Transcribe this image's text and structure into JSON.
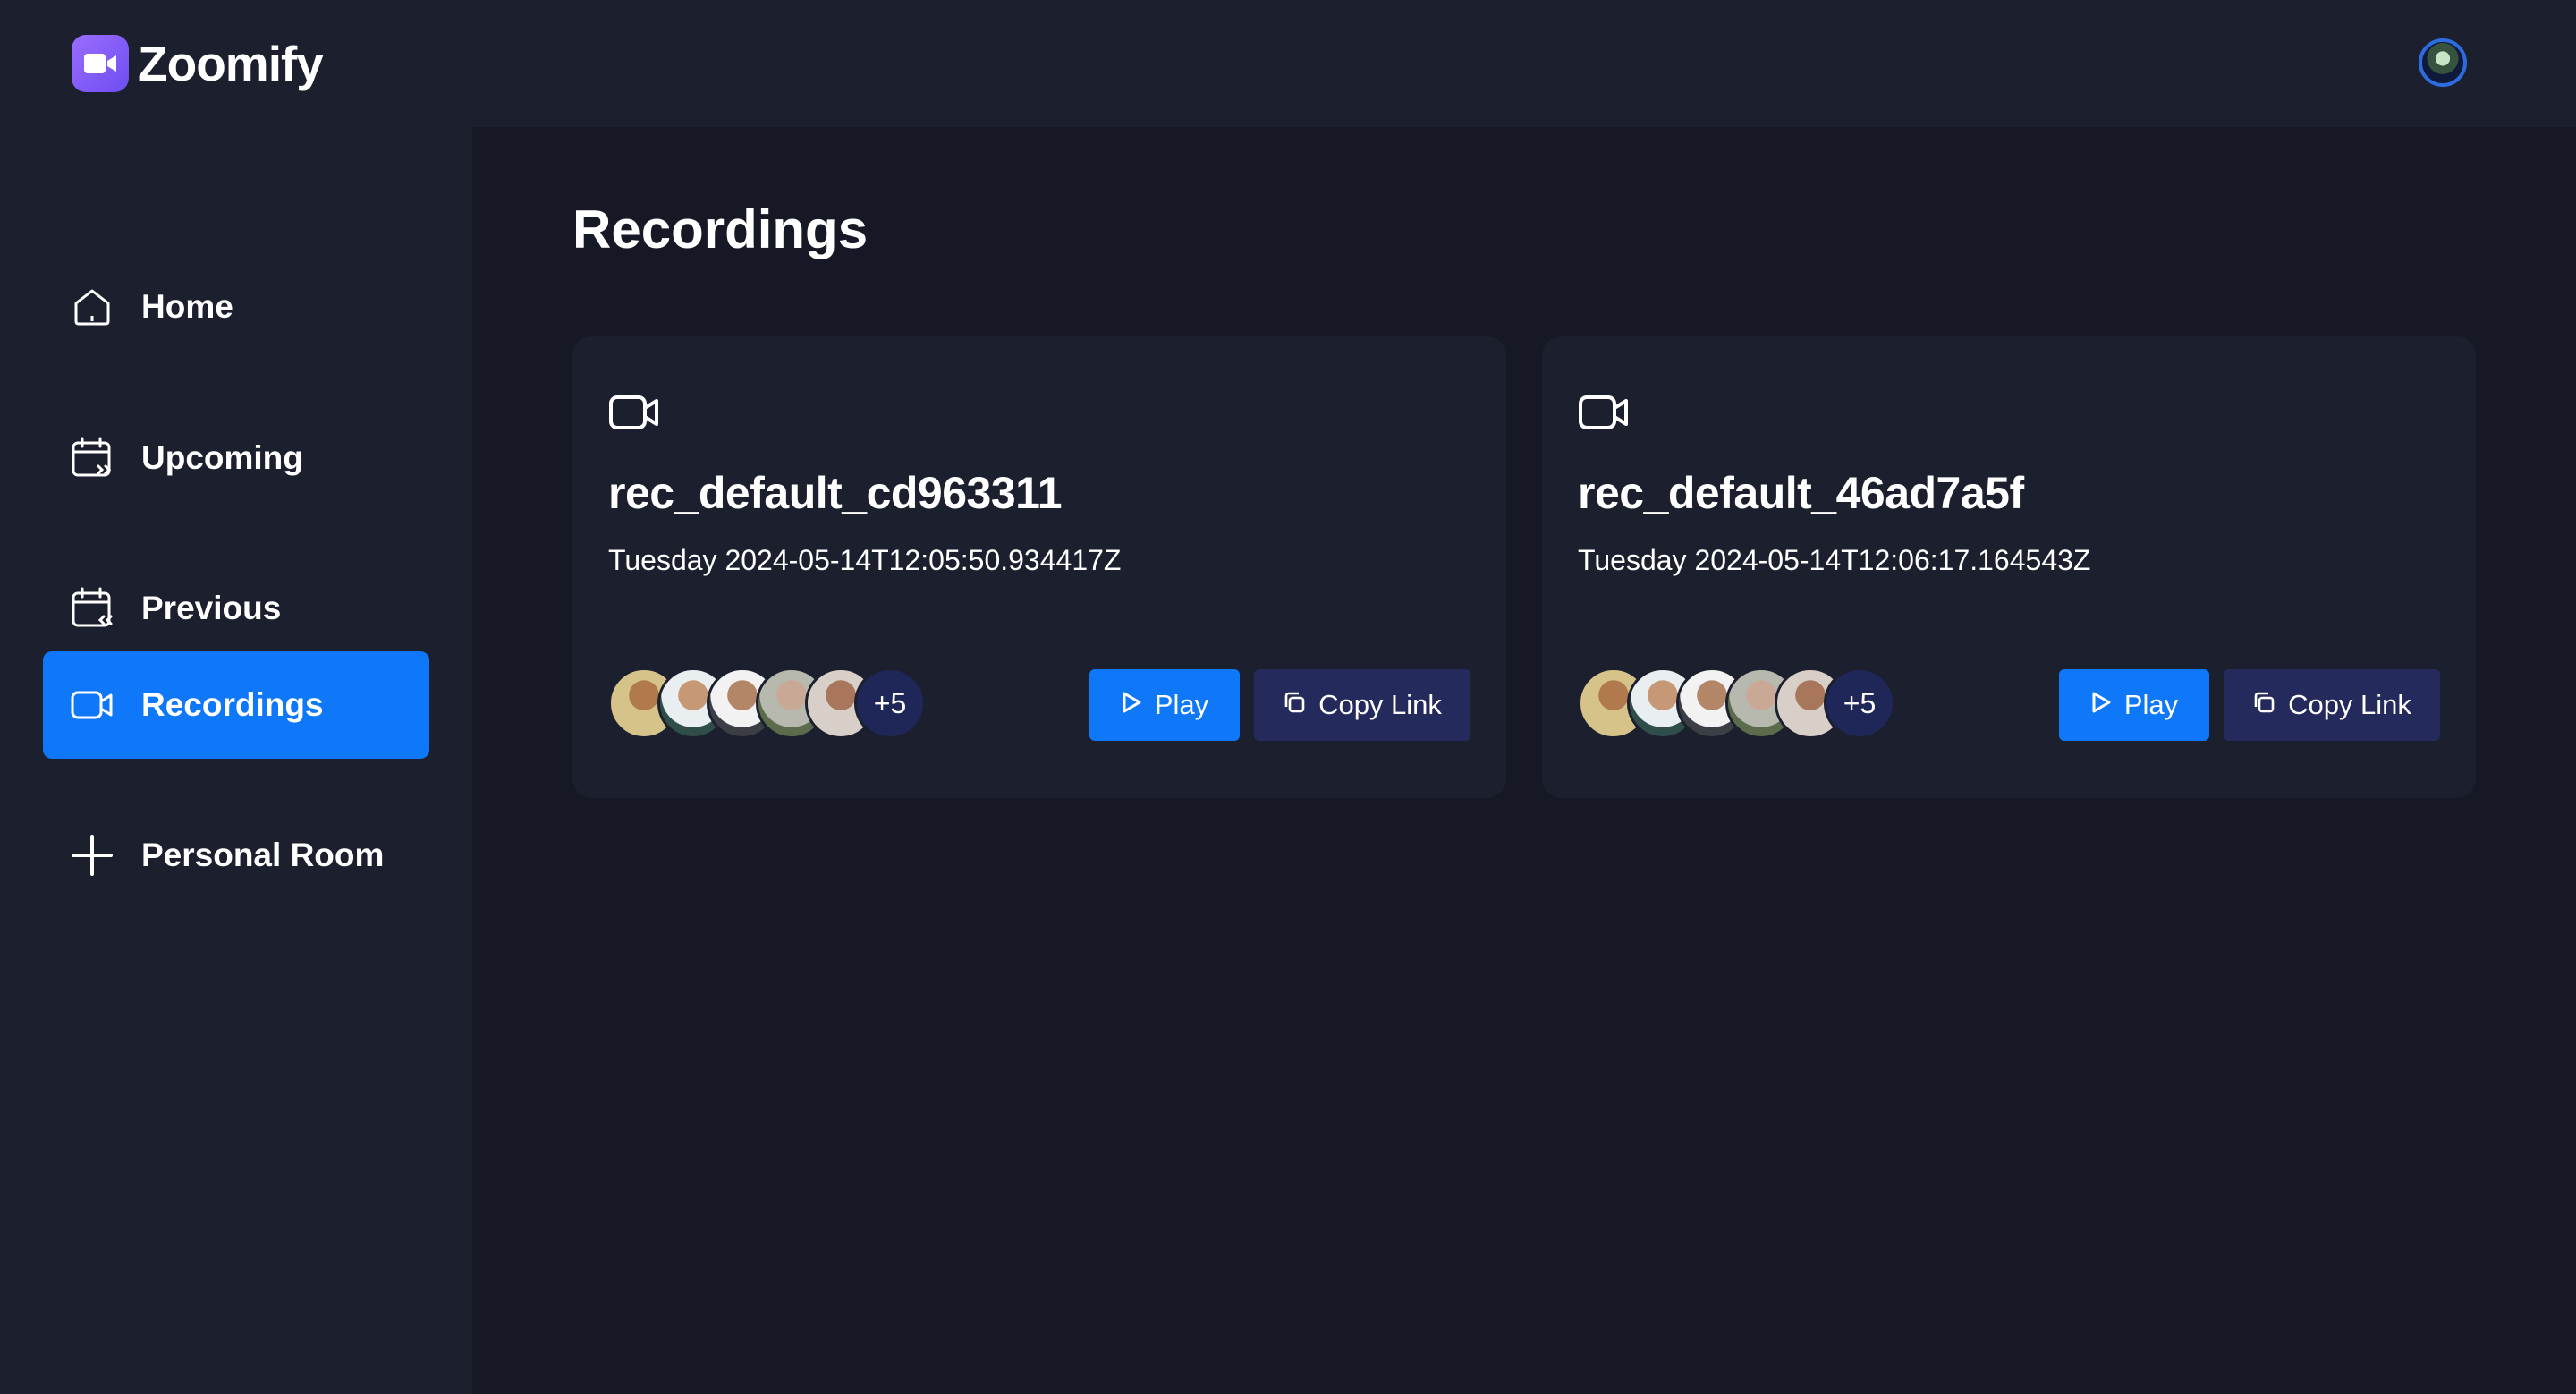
{
  "app": {
    "name": "Zoomify"
  },
  "sidebar": {
    "items": [
      {
        "label": "Home",
        "icon": "home-icon",
        "active": false
      },
      {
        "label": "Upcoming",
        "icon": "calendar-forward-icon",
        "active": false
      },
      {
        "label": "Previous",
        "icon": "calendar-back-icon",
        "active": false
      },
      {
        "label": "Recordings",
        "icon": "video-icon",
        "active": true
      },
      {
        "label": "Personal Room",
        "icon": "plus-icon",
        "active": false
      }
    ]
  },
  "main": {
    "title": "Recordings",
    "recordings": [
      {
        "title": "rec_default_cd963311",
        "date": "Tuesday 2024-05-14T12:05:50.934417Z",
        "more_attendees": "+5",
        "play_label": "Play",
        "copy_label": "Copy Link"
      },
      {
        "title": "rec_default_46ad7a5f",
        "date": "Tuesday 2024-05-14T12:06:17.164543Z",
        "more_attendees": "+5",
        "play_label": "Play",
        "copy_label": "Copy Link"
      }
    ]
  },
  "colors": {
    "accent": "#0e78f9",
    "sidebar_bg": "#1c1f2e",
    "main_bg": "#161925",
    "copy_button_bg": "#252a5c"
  }
}
